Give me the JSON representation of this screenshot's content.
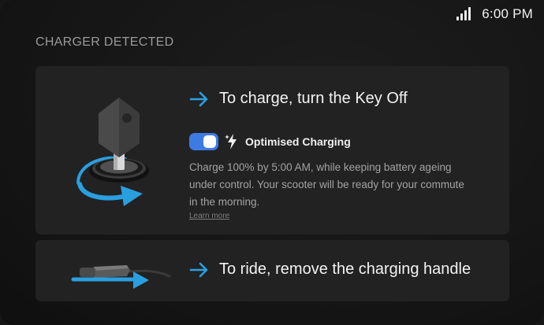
{
  "status_bar": {
    "time": "6:00 PM",
    "signal_icon": "signal-bars-icon",
    "signal_level": 4
  },
  "heading": "CHARGER DETECTED",
  "key_card": {
    "title": "To charge, turn the Key Off",
    "arrow_icon": "arrow-right-icon",
    "illustration": "key-turn-illustration",
    "toggle": {
      "state": "on",
      "label": "Optimised Charging",
      "icon": "sparkle-bolt-icon"
    },
    "description": "Charge 100% by 5:00 AM, while keeping battery ageing under control. Your scooter will be ready for your commute in the morning.",
    "learn_more": "Learn more"
  },
  "ride_card": {
    "title": "To ride, remove the charging handle",
    "arrow_icon": "arrow-right-icon",
    "illustration": "charging-plug-illustration"
  },
  "colors": {
    "accent_blue": "#2a9fe0",
    "toggle_on": "#3d7be3",
    "card_bg": "#222222",
    "screen_bg": "#161616"
  }
}
